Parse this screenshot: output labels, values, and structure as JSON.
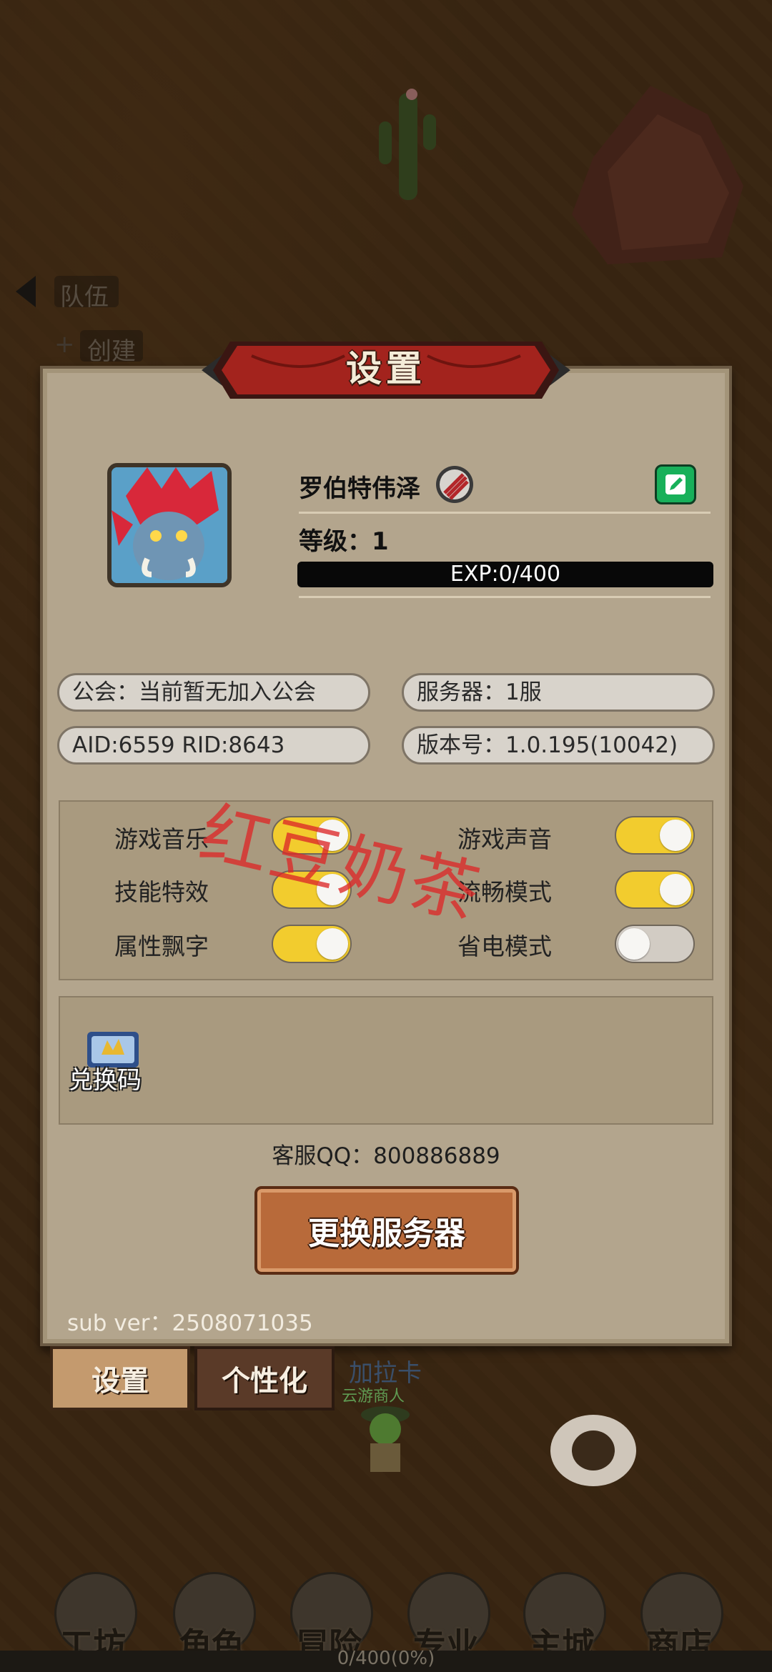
{
  "background": {
    "back_label": "队伍",
    "create_label": "创建"
  },
  "panel": {
    "title": "设置",
    "player": {
      "name": "罗伯特伟泽",
      "level_text": "等级：1",
      "exp_text": "EXP:0/400",
      "exp_progress": 0
    },
    "info": {
      "guild": "公会：当前暂无加入公会",
      "server": "服务器：1服",
      "ids": "AID:6559   RID:8643",
      "version": "版本号：1.0.195(10042)"
    },
    "toggles": [
      {
        "label": "游戏音乐",
        "on": true
      },
      {
        "label": "游戏声音",
        "on": true
      },
      {
        "label": "技能特效",
        "on": true
      },
      {
        "label": "流畅模式",
        "on": true
      },
      {
        "label": "属性飘字",
        "on": true
      },
      {
        "label": "省电模式",
        "on": false
      }
    ],
    "redeem_label": "兑换码",
    "support_qq": "客服QQ：800886889",
    "switch_server_label": "更换服务器",
    "sub_version": "sub ver：2508071035"
  },
  "tabs": {
    "settings": "设置",
    "personalize": "个性化"
  },
  "garlic_card": {
    "label": "加拉卡",
    "sub": "云游商人"
  },
  "nav": [
    {
      "label": "工坊",
      "icon": "workshop-icon"
    },
    {
      "label": "角色",
      "icon": "character-icon"
    },
    {
      "label": "冒险",
      "icon": "adventure-icon"
    },
    {
      "label": "专业",
      "icon": "profession-icon"
    },
    {
      "label": "主城",
      "icon": "castle-icon"
    },
    {
      "label": "商店",
      "icon": "shop-icon"
    }
  ],
  "bottom_progress_text": "0/400(0%)",
  "watermark": "红豆奶茶",
  "colors": {
    "panel_bg": "#b3a58d",
    "toggle_on": "#f2cc2e",
    "toggle_off": "#d2ccc4",
    "edit_button": "#18b05a",
    "title_banner": "#a3231d",
    "watermark": "#dc2828"
  }
}
